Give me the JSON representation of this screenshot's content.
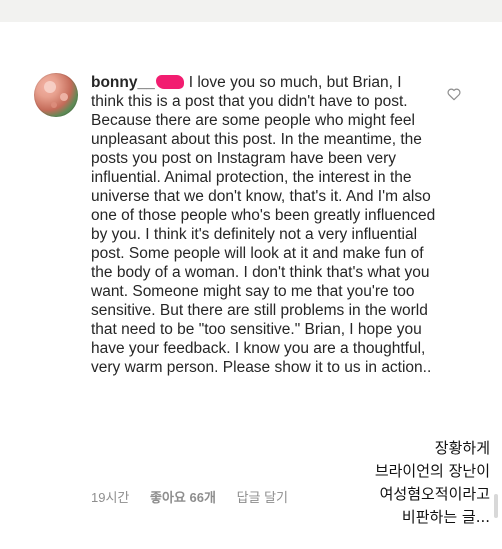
{
  "comment": {
    "username": "bonny__",
    "text": "I love you so much, but Brian, I think this is a post that you didn't have to post. Because there are some people who might feel unpleasant about this post. In the meantime, the posts you post on Instagram have been very influential. Animal protection, the interest in the universe that we don't know, that's it. And I'm also one of those people who's been greatly influenced by you. I think it's definitely not a very influential post. Some people will look at it and make fun of the body of a woman. I don't think that's what you want. Someone might say to me that you're too sensitive. But there are still problems in the world that need to be \"too sensitive.\" Brian, I hope you have your feedback. I know you are a thoughtful, very warm person. Please show it to us in action..",
    "time": "19시간",
    "likes": "좋아요 66개",
    "reply": "답글 달기"
  },
  "overlay_caption": {
    "lines": [
      "장황하게",
      "브라이언의 장난이",
      "여성혐오적이라고",
      "비판하는 글..."
    ]
  },
  "icons": {
    "like": "heart-outline-icon"
  },
  "colors": {
    "text": "#262626",
    "meta": "#8e8e8e",
    "redaction": "#f21d70"
  }
}
